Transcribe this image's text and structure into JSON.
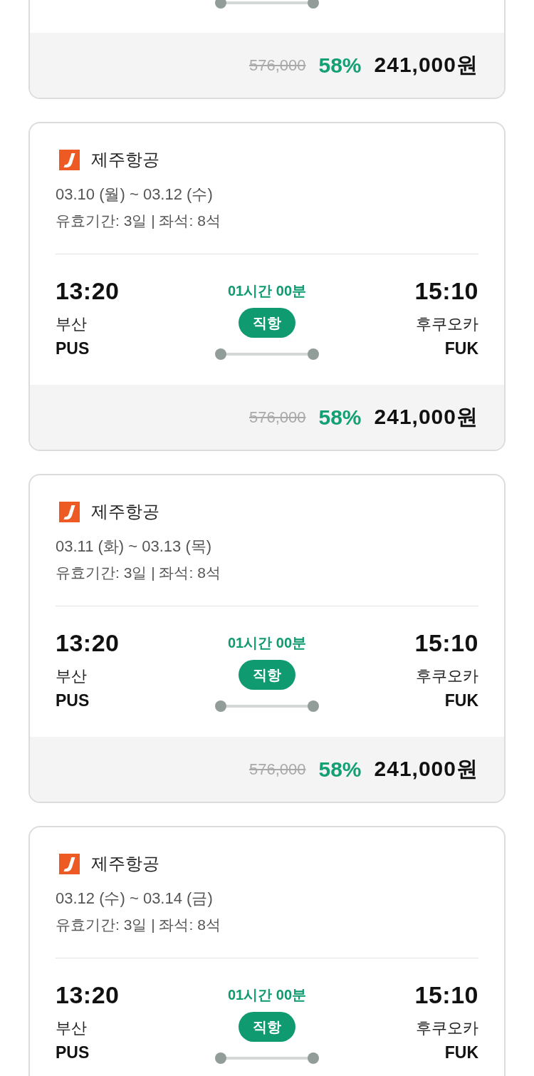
{
  "cards": [
    {
      "kind": "tail",
      "price": {
        "original": "576,000",
        "discount": "58%",
        "final": "241,000원"
      }
    },
    {
      "kind": "full",
      "airline": "제주항공",
      "dates": "03.10 (월) ~ 03.12 (수)",
      "validity": "유효기간: 3일 | 좌석: 8석",
      "departure": {
        "time": "13:20",
        "city": "부산",
        "code": "PUS"
      },
      "duration": "01시간 00분",
      "flight_type": "직항",
      "arrival": {
        "time": "15:10",
        "city": "후쿠오카",
        "code": "FUK"
      },
      "price": {
        "original": "576,000",
        "discount": "58%",
        "final": "241,000원"
      }
    },
    {
      "kind": "full",
      "airline": "제주항공",
      "dates": "03.11 (화) ~ 03.13 (목)",
      "validity": "유효기간: 3일 | 좌석: 8석",
      "departure": {
        "time": "13:20",
        "city": "부산",
        "code": "PUS"
      },
      "duration": "01시간 00분",
      "flight_type": "직항",
      "arrival": {
        "time": "15:10",
        "city": "후쿠오카",
        "code": "FUK"
      },
      "price": {
        "original": "576,000",
        "discount": "58%",
        "final": "241,000원"
      }
    },
    {
      "kind": "head",
      "airline": "제주항공",
      "dates": "03.12 (수) ~ 03.14 (금)",
      "validity": "유효기간: 3일 | 좌석: 8석",
      "departure": {
        "time": "13:20",
        "city": "부산",
        "code": "PUS"
      },
      "duration": "01시간 00분",
      "flight_type": "직항",
      "arrival": {
        "time": "15:10",
        "city": "후쿠오카",
        "code": "FUK"
      }
    }
  ]
}
